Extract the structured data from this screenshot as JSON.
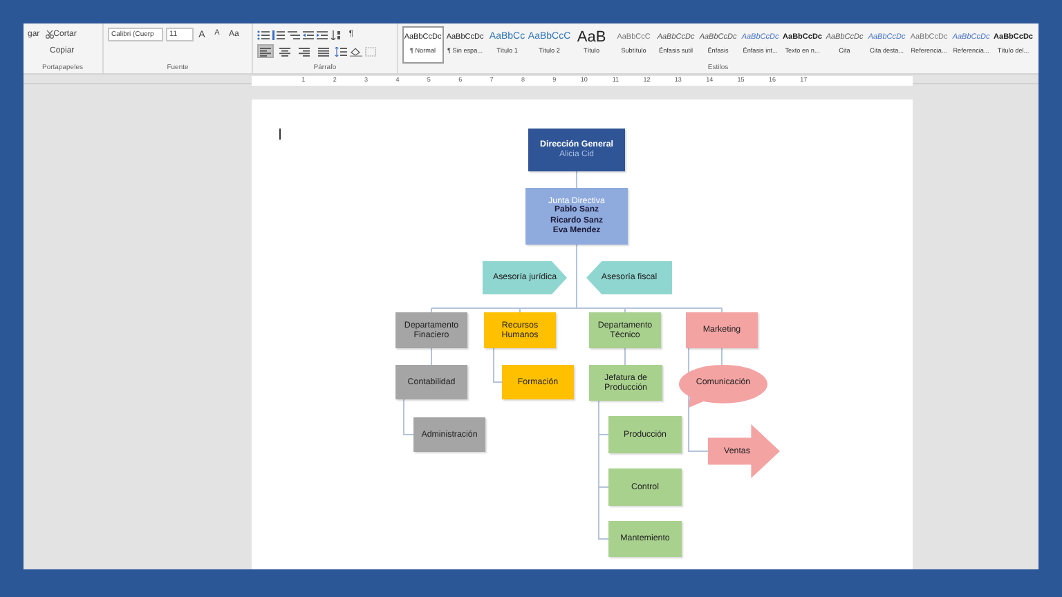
{
  "clipboard": {
    "paste": "gar",
    "cut": "Cortar",
    "copy": "Copiar",
    "label": "Portapapeles"
  },
  "font": {
    "name": "Calibri (Cuerp",
    "size": "11",
    "grow": "A",
    "shrink": "A",
    "case": "Aa",
    "label": "Fuente"
  },
  "paragraph": {
    "label": "Párrafo",
    "pilcrow": "¶",
    "align": [
      {
        "selected": true
      },
      {
        "selected": false
      },
      {
        "selected": false
      },
      {
        "selected": false
      }
    ]
  },
  "styles": {
    "label": "Estilos",
    "items": [
      {
        "preview": "AaBbCcDc",
        "name": "¶ Normal",
        "kind": "body",
        "selected": true
      },
      {
        "preview": "AaBbCcDc",
        "name": "¶ Sin espa...",
        "kind": "body",
        "selected": false
      },
      {
        "preview": "AaBbCc",
        "name": "Título 1",
        "kind": "heading",
        "selected": false
      },
      {
        "preview": "AaBbCcC",
        "name": "Título 2",
        "kind": "heading",
        "selected": false
      },
      {
        "preview": "AaB",
        "name": "Título",
        "kind": "title",
        "selected": false
      },
      {
        "preview": "AaBbCcC",
        "name": "Subtítulo",
        "kind": "subtle",
        "selected": false
      },
      {
        "preview": "AaBbCcDc",
        "name": "Énfasis sutil",
        "kind": "emphasis",
        "selected": false
      },
      {
        "preview": "AaBbCcDc",
        "name": "Énfasis",
        "kind": "emphasis",
        "selected": false
      },
      {
        "preview": "AaBbCcDc",
        "name": "Énfasis int...",
        "kind": "accent",
        "selected": false
      },
      {
        "preview": "AaBbCcDc",
        "name": "Texto en n...",
        "kind": "strong",
        "selected": false
      },
      {
        "preview": "AaBbCcDc",
        "name": "Cita",
        "kind": "emphasis",
        "selected": false
      },
      {
        "preview": "AaBbCcDc",
        "name": "Cita desta...",
        "kind": "accent",
        "selected": false
      },
      {
        "preview": "AaBbCcDc",
        "name": "Referencia...",
        "kind": "subtle",
        "selected": false
      },
      {
        "preview": "AaBbCcDc",
        "name": "Referencia...",
        "kind": "accent",
        "selected": false
      },
      {
        "preview": "AaBbCcDc",
        "name": "Título del...",
        "kind": "strong",
        "selected": false
      }
    ]
  },
  "ruler": {
    "marks": [
      "1",
      "2",
      "3",
      "4",
      "5",
      "6",
      "7",
      "8",
      "9",
      "10",
      "11",
      "12",
      "13",
      "14",
      "15",
      "16",
      "17"
    ]
  },
  "org_chart": {
    "root": {
      "title": "Dirección General",
      "details": [
        "Alicia Cid"
      ],
      "kind": "box",
      "color": "#2f5597",
      "children": [
        {
          "title": "Junta Directiva",
          "details": [
            "Pablo Sanz",
            "Ricardo Sanz",
            "Eva Mendez"
          ],
          "kind": "box",
          "color": "#8faadc",
          "children": [
            {
              "title": "Asesoría jurídica",
              "kind": "tag-right",
              "color": "#8fd6d0"
            },
            {
              "title": "Asesoría fiscal",
              "kind": "tag-left",
              "color": "#8fd6d0"
            },
            {
              "title": "Departamento Finaciero",
              "kind": "box",
              "color": "#a5a5a5",
              "children": [
                {
                  "title": "Contabilidad",
                  "kind": "box",
                  "color": "#a5a5a5",
                  "children": [
                    {
                      "title": "Administración",
                      "kind": "box",
                      "color": "#a5a5a5"
                    }
                  ]
                }
              ]
            },
            {
              "title": "Recursos Humanos",
              "kind": "box",
              "color": "#ffc000",
              "children": [
                {
                  "title": "Formación",
                  "kind": "box",
                  "color": "#ffc000"
                }
              ]
            },
            {
              "title": "Departamento Técnico",
              "kind": "box",
              "color": "#a9d18e",
              "children": [
                {
                  "title": "Jefatura de Producción",
                  "kind": "box",
                  "color": "#a9d18e",
                  "children": [
                    {
                      "title": "Producción",
                      "kind": "box",
                      "color": "#a9d18e"
                    },
                    {
                      "title": "Control",
                      "kind": "box",
                      "color": "#a9d18e"
                    },
                    {
                      "title": "Mantemiento",
                      "kind": "box",
                      "color": "#a9d18e"
                    }
                  ]
                }
              ]
            },
            {
              "title": "Marketing",
              "kind": "box",
              "color": "#f4a3a3",
              "children": [
                {
                  "title": "Comunicación",
                  "kind": "callout",
                  "color": "#f4a3a3"
                },
                {
                  "title": "Ventas",
                  "kind": "arrow",
                  "color": "#f4a3a3"
                }
              ]
            }
          ]
        }
      ]
    }
  }
}
